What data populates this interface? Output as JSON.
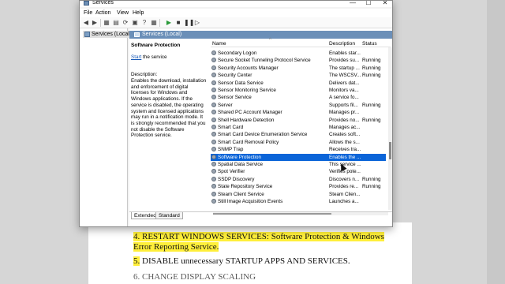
{
  "window": {
    "title": "Services",
    "controls": {
      "minimize": "—",
      "maximize": "☐",
      "close": "✕"
    }
  },
  "menu": [
    "File",
    "Action",
    "View",
    "Help"
  ],
  "toolbar": [
    "◀",
    "▶",
    "▦",
    "▤",
    "⟳",
    "▣",
    "?",
    "▦",
    "▶",
    "■",
    "❚❚",
    "▷"
  ],
  "tree": {
    "item": "Services (Local)"
  },
  "pane": {
    "header": "Services (Local)",
    "desc_title": "Software Protection",
    "start_link": "Start",
    "start_suffix": " the service",
    "desc_label": "Description:",
    "desc_body": "Enables the download, installation and enforcement of digital licenses for Windows and Windows applications. If the service is disabled, the operating system and licensed applications may run in a notification mode. It is strongly recommended that you not disable the Software Protection service."
  },
  "columns": {
    "name": "Name",
    "description": "Description",
    "status": "Status",
    "sort": "^"
  },
  "services": [
    {
      "name": "Secondary Logon",
      "description": "Enables star...",
      "status": ""
    },
    {
      "name": "Secure Socket Tunneling Protocol Service",
      "description": "Provides su...",
      "status": "Running"
    },
    {
      "name": "Security Accounts Manager",
      "description": "The startup ...",
      "status": "Running"
    },
    {
      "name": "Security Center",
      "description": "The WSCSV...",
      "status": "Running"
    },
    {
      "name": "Sensor Data Service",
      "description": "Delivers dat...",
      "status": ""
    },
    {
      "name": "Sensor Monitoring Service",
      "description": "Monitors va...",
      "status": ""
    },
    {
      "name": "Sensor Service",
      "description": "A service fo...",
      "status": ""
    },
    {
      "name": "Server",
      "description": "Supports fil...",
      "status": "Running"
    },
    {
      "name": "Shared PC Account Manager",
      "description": "Manages pr...",
      "status": ""
    },
    {
      "name": "Shell Hardware Detection",
      "description": "Provides no...",
      "status": "Running"
    },
    {
      "name": "Smart Card",
      "description": "Manages ac...",
      "status": ""
    },
    {
      "name": "Smart Card Device Enumeration Service",
      "description": "Creates soft...",
      "status": ""
    },
    {
      "name": "Smart Card Removal Policy",
      "description": "Allows the s...",
      "status": ""
    },
    {
      "name": "SNMP Trap",
      "description": "Receives tra...",
      "status": ""
    },
    {
      "name": "Software Protection",
      "description": "Enables the ...",
      "status": "",
      "selected": true
    },
    {
      "name": "Spatial Data Service",
      "description": "This service ...",
      "status": ""
    },
    {
      "name": "Spot Verifier",
      "description": "Verifies pote...",
      "status": ""
    },
    {
      "name": "SSDP Discovery",
      "description": "Discovers n...",
      "status": "Running"
    },
    {
      "name": "State Repository Service",
      "description": "Provides re...",
      "status": "Running"
    },
    {
      "name": "Steam Client Service",
      "description": "Steam Clien...",
      "status": ""
    },
    {
      "name": "Still Image Acquisition Events",
      "description": "Launches a...",
      "status": ""
    }
  ],
  "tabs": [
    "Extended",
    "Standard"
  ],
  "document": {
    "line1_num": "4.",
    "line1": " RESTART WINDOWS SERVICES: Software Protection & Windows",
    "line2": "Error Reporting Service.",
    "line3_num": "5.",
    "line3": " DISABLE unnecessary STARTUP APPS AND SERVICES.",
    "line4": "6. CHANGE DISPLAY SCALING"
  }
}
